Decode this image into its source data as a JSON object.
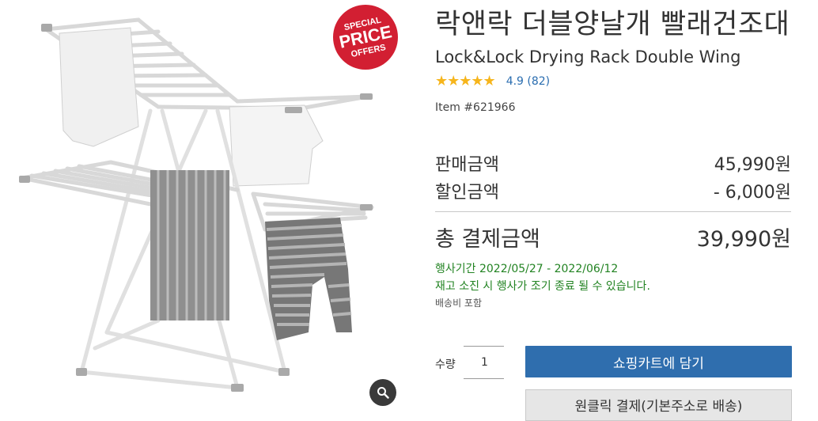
{
  "badge": {
    "line1": "SPECIAL",
    "line2": "PRICE",
    "line3": "OFFERS"
  },
  "product": {
    "title_ko": "락앤락 더블양날개 빨래건조대",
    "title_en": "Lock&Lock Drying Rack Double Wing",
    "stars": "★★★★★",
    "rating_text": "4.9  (82)",
    "item_number": "Item #621966"
  },
  "pricing": {
    "sale_label": "판매금액",
    "sale_value": "45,990원",
    "discount_label": "할인금액",
    "discount_value": "- 6,000원",
    "total_label": "총 결제금액",
    "total_value": "39,990원"
  },
  "promo": {
    "period": "행사기간 2022/05/27 - 2022/06/12",
    "notice": "재고 소진 시 행사가 조기 종료 될 수 있습니다.",
    "shipping": "배송비 포함"
  },
  "purchase": {
    "qty_label": "수량",
    "qty_value": "1",
    "cart_button": "쇼핑카트에 담기",
    "oneclick_button": "원클릭 결제(기본주소로 배송)"
  },
  "colors": {
    "badge_red": "#d21f32",
    "primary_blue": "#2f6eae",
    "rating_blue": "#2a6db0",
    "promo_green": "#228322",
    "star": "#f6b51c"
  },
  "icons": {
    "zoom": "magnifier-icon"
  }
}
